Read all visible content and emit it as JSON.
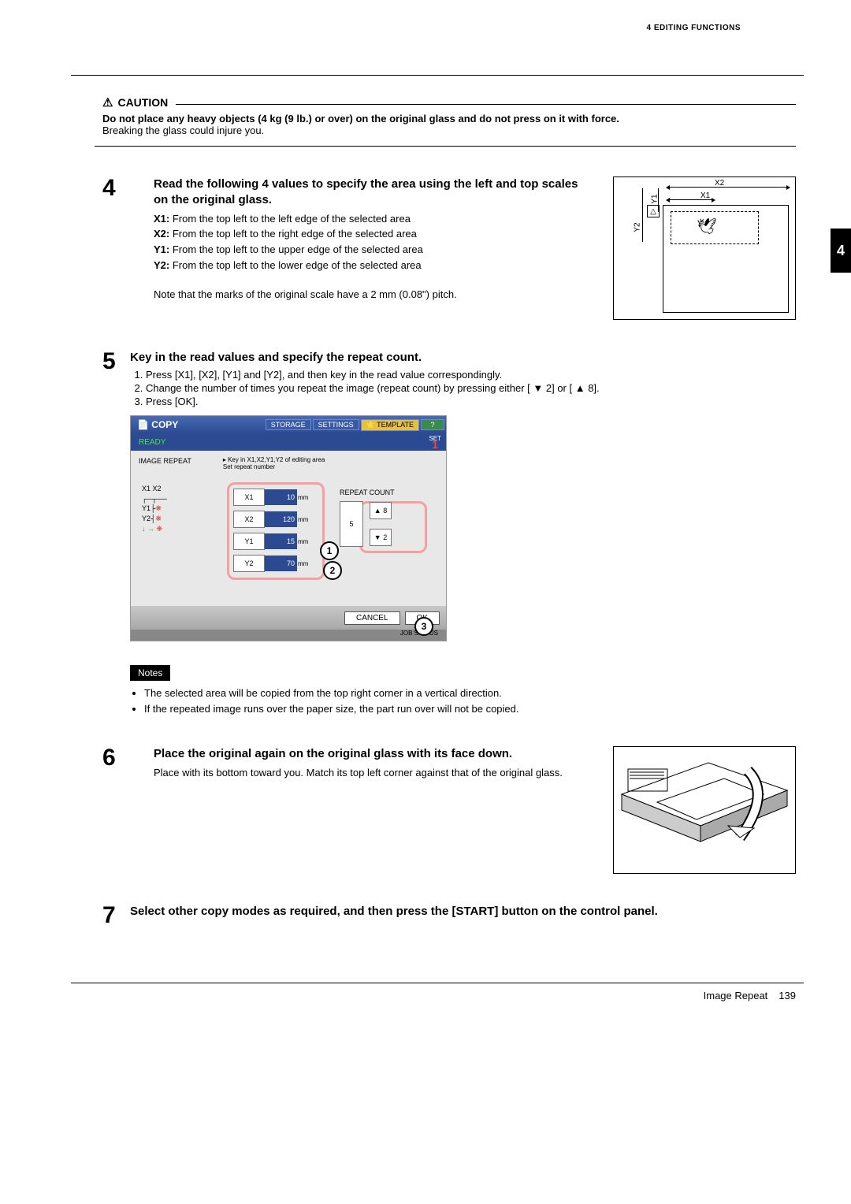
{
  "header": {
    "section": "4 EDITING FUNCTIONS"
  },
  "side_tab": "4",
  "caution": {
    "title": "CAUTION",
    "bold_text": "Do not place any heavy objects (4 kg (9 lb.) or over) on the original glass and do not press on it with force.",
    "text": "Breaking the glass could injure you."
  },
  "step4": {
    "num": "4",
    "title": "Read the following 4 values to specify the area using the left and top scales on the original glass.",
    "items": [
      {
        "k": "X1:",
        "v": " From the top left to the left edge of the selected area"
      },
      {
        "k": "X2:",
        "v": " From the top left to the right edge of the selected area"
      },
      {
        "k": "Y1:",
        "v": " From the top left to the upper edge of the selected area"
      },
      {
        "k": "Y2:",
        "v": " From the top left to the lower edge of the selected area"
      }
    ],
    "note": "Note that the marks of the original scale have a 2 mm (0.08\") pitch.",
    "labels": {
      "x1": "X1",
      "x2": "X2",
      "y1": "Y1",
      "y2": "Y2"
    }
  },
  "step5": {
    "num": "5",
    "title": "Key in the read values and specify the repeat count.",
    "list": [
      "Press [X1], [X2], [Y1] and [Y2], and then key in the read value correspondingly.",
      "Change the number of times you repeat the image (repeat count) by pressing either [ ▼ 2] or [ ▲ 8].",
      "Press [OK]."
    ],
    "screen": {
      "copy": "COPY",
      "storage": "STORAGE",
      "settings": "SETTINGS",
      "template": "TEMPLATE",
      "help": "?",
      "ready": "READY",
      "set": "SET",
      "one": "1",
      "mode_label": "IMAGE REPEAT",
      "hint1": "▸ Key in X1,X2,Y1,Y2 of editing area",
      "hint2": "Set repeat number",
      "small_diag": {
        "l1": "X1  X2",
        "l2": "Y1",
        "l3": "Y2"
      },
      "inputs": [
        {
          "lab": "X1",
          "val": "10",
          "mm": "mm"
        },
        {
          "lab": "X2",
          "val": "120",
          "mm": "mm"
        },
        {
          "lab": "Y1",
          "val": "15",
          "mm": "mm"
        },
        {
          "lab": "Y2",
          "val": "70",
          "mm": "mm"
        }
      ],
      "repeat_title": "REPEAT COUNT",
      "repeat_up": "▲   8",
      "repeat_val": "5",
      "repeat_down": "▼   2",
      "cancel": "CANCEL",
      "ok": "OK",
      "jobstatus": "JOB STATUS",
      "callouts": {
        "c1": "1",
        "c2": "2",
        "c3": "3"
      }
    }
  },
  "notes": {
    "label": "Notes",
    "items": [
      "The selected area will be copied from the top right corner in a vertical direction.",
      "If the repeated image runs over the paper size, the part run over will not be copied."
    ]
  },
  "step6": {
    "num": "6",
    "title": "Place the original again on the original glass with its face down.",
    "text": "Place with its bottom toward you. Match its top left corner against that of the original glass."
  },
  "step7": {
    "num": "7",
    "title": "Select other copy modes as required, and then press the [START] button on the control panel."
  },
  "footer": {
    "title": "Image Repeat",
    "page": "139"
  }
}
